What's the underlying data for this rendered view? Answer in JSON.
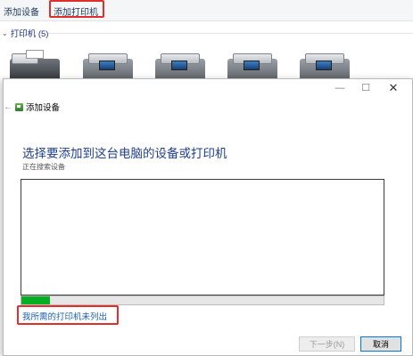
{
  "toolbar": {
    "add_device": "添加设备",
    "add_printer": "添加打印机"
  },
  "group": {
    "chevron": "⌄",
    "label": "打印机 (5)"
  },
  "dialog": {
    "minimize_glyph": "—",
    "maximize_glyph": "☐",
    "close_glyph": "✕",
    "back_glyph": "←",
    "title": "添加设备",
    "heading": "选择要添加到这台电脑的设备或打印机",
    "status": "正在搜索设备",
    "progress": 0.08,
    "missing_printer_link": "我所需的打印机未列出",
    "next_button": "下一步(N)",
    "cancel_button": "取消"
  },
  "colors": {
    "highlight_box": "#e0302b",
    "progress_fill": "#06b025",
    "link": "#1a5fb4",
    "heading": "#1f3f8c"
  },
  "icons": [
    "fax-printer-icon",
    "printer-icon",
    "printer-icon",
    "printer-icon",
    "printer-icon",
    "wizard-icon",
    "back-arrow-icon",
    "close-icon"
  ]
}
